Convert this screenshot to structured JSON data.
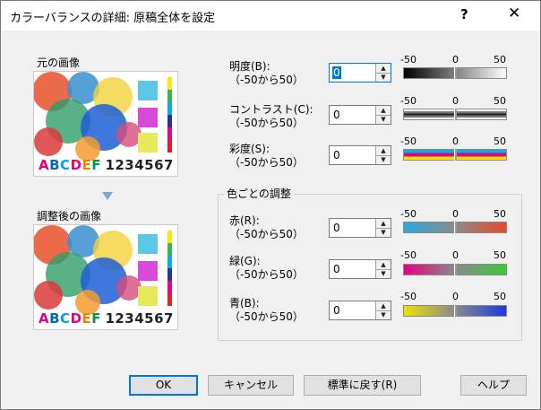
{
  "window": {
    "title": "カラーバランスの詳細: 原稿全体を設定",
    "help_label": "?",
    "close_label": "✕"
  },
  "original": {
    "label": "元の画像",
    "text_abc": [
      "A",
      "B",
      "C",
      "D",
      "E",
      "F"
    ],
    "text_num": "1234567"
  },
  "adjusted": {
    "label": "調整後の画像",
    "text_abc": [
      "A",
      "B",
      "C",
      "D",
      "E",
      "F"
    ],
    "text_num": "1234567"
  },
  "scale": {
    "min": "-50",
    "mid": "0",
    "max": "50"
  },
  "brightness": {
    "label": "明度(B):",
    "range": "（-50から50）",
    "value": "0"
  },
  "contrast": {
    "label": "コントラスト(C):",
    "range": "（-50から50）",
    "value": "0"
  },
  "saturation": {
    "label": "彩度(S):",
    "range": "（-50から50）",
    "value": "0"
  },
  "color_group": {
    "title": "色ごとの調整"
  },
  "red": {
    "label": "赤(R):",
    "range": "（-50から50）",
    "value": "0"
  },
  "green": {
    "label": "緑(G):",
    "range": "（-50から50）",
    "value": "0"
  },
  "blue": {
    "label": "青(B):",
    "range": "（-50から50）",
    "value": "0"
  },
  "buttons": {
    "ok": "OK",
    "cancel": "キャンセル",
    "reset": "標準に戻す(R)",
    "help": "ヘルプ"
  },
  "colors": {
    "accent": "#0078d7",
    "abc": [
      "#e4007f",
      "#0068b7",
      "#00a0e9",
      "#e4007f",
      "#f08300",
      "#009944"
    ]
  }
}
